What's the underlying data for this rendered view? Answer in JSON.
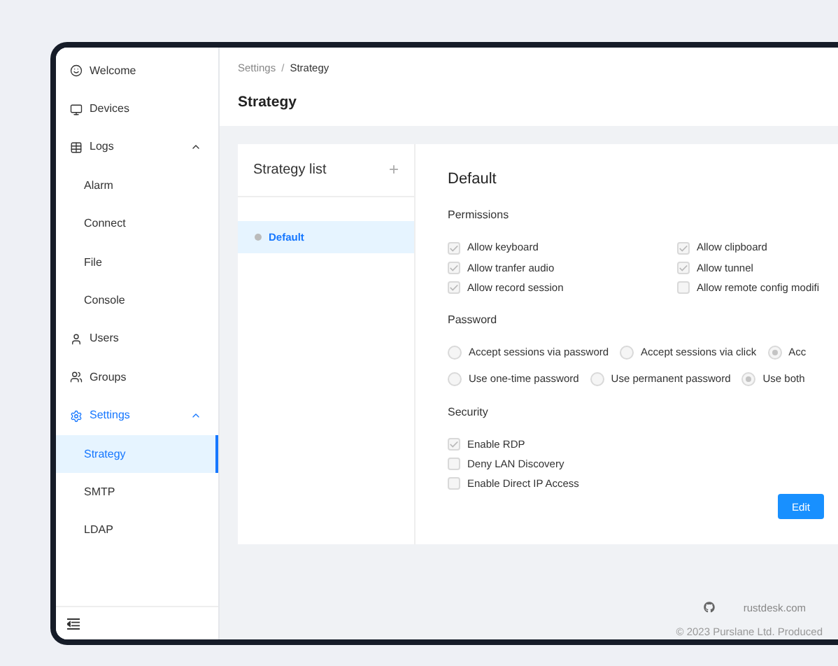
{
  "sidebar": {
    "items": [
      {
        "label": "Welcome",
        "selected": false
      },
      {
        "label": "Devices",
        "selected": false
      },
      {
        "label": "Logs",
        "selected": false,
        "expanded": true,
        "children": [
          {
            "label": "Alarm",
            "selected": false
          },
          {
            "label": "Connect",
            "selected": false
          },
          {
            "label": "File",
            "selected": false
          },
          {
            "label": "Console",
            "selected": false
          }
        ]
      },
      {
        "label": "Users",
        "selected": false
      },
      {
        "label": "Groups",
        "selected": false
      },
      {
        "label": "Settings",
        "selected": false,
        "expanded": true,
        "children": [
          {
            "label": "Strategy",
            "selected": true
          },
          {
            "label": "SMTP",
            "selected": false
          },
          {
            "label": "LDAP",
            "selected": false
          }
        ]
      }
    ]
  },
  "breadcrumb": [
    "Settings",
    "Strategy"
  ],
  "breadcrumb_separator": "/",
  "page_title": "Strategy",
  "strategy_list": {
    "title": "Strategy list",
    "add_icon": "+",
    "items": [
      {
        "label": "Default",
        "selected": true
      }
    ]
  },
  "detail": {
    "title": "Default",
    "sections": [
      {
        "kind": "checkbox-grid",
        "title": "Permissions",
        "options": [
          {
            "label": "Allow keyboard",
            "checked": true
          },
          {
            "label": "Allow clipboard",
            "checked": true
          },
          {
            "label": "Allow tranfer audio",
            "checked": true
          },
          {
            "label": "Allow tunnel",
            "checked": true
          },
          {
            "label": "Allow record session",
            "checked": true
          },
          {
            "label": "Allow remote config modifi",
            "checked": false
          }
        ]
      },
      {
        "kind": "radios",
        "title": "Password",
        "groups": [
          [
            {
              "label": "Accept sessions via password",
              "selected": false
            },
            {
              "label": "Accept sessions via click",
              "selected": false
            },
            {
              "label": "Acc",
              "selected": true
            }
          ],
          [
            {
              "label": "Use one-time password",
              "selected": false
            },
            {
              "label": "Use permanent password",
              "selected": false
            },
            {
              "label": "Use both",
              "selected": true
            }
          ]
        ]
      },
      {
        "kind": "checkbox-list",
        "title": "Security",
        "options": [
          {
            "label": "Enable RDP",
            "checked": true
          },
          {
            "label": "Deny LAN Discovery",
            "checked": false
          },
          {
            "label": "Enable Direct IP Access",
            "checked": false
          }
        ]
      }
    ],
    "button": "Edit"
  },
  "footer": {
    "link": "rustdesk.com",
    "copyright": "© 2023 Purslane Ltd. Produced"
  }
}
